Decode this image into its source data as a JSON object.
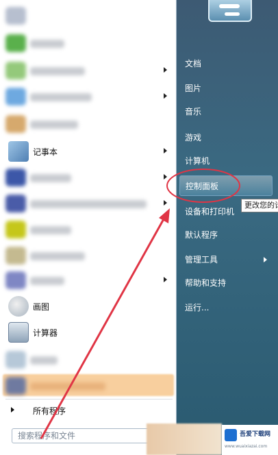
{
  "left_items": [
    {
      "type": "blurred",
      "icon_color": "#b7bfcf",
      "text_w": 0,
      "arrow": false
    },
    {
      "type": "blurred",
      "icon_color": "#5ab04c",
      "text_w": 50,
      "arrow": false
    },
    {
      "type": "blurred",
      "icon_color": "#94c97b",
      "text_w": 80,
      "arrow": true
    },
    {
      "type": "blurred",
      "icon_color": "#6ea9e0",
      "text_w": 90,
      "arrow": true
    },
    {
      "type": "blurred",
      "icon_color": "#d6a96d",
      "text_w": 70,
      "arrow": false
    }
  ],
  "notepad_label": "记事本",
  "paint_label": "画图",
  "calculator_label": "计算器",
  "all_programs_label": "所有程序",
  "search_placeholder": "搜索程序和文件",
  "right_items": [
    {
      "label": "文档",
      "arrow": false
    },
    {
      "label": "图片",
      "arrow": false
    },
    {
      "label": "音乐",
      "arrow": false
    },
    {
      "label": "游戏",
      "arrow": false
    },
    {
      "label": "计算机",
      "arrow": false
    },
    {
      "label": "控制面板",
      "arrow": false,
      "highlighted": true
    },
    {
      "label": "设备和打印机",
      "arrow": false
    },
    {
      "label": "默认程序",
      "arrow": false
    },
    {
      "label": "管理工具",
      "arrow": true
    },
    {
      "label": "帮助和支持",
      "arrow": false
    },
    {
      "label": "运行...",
      "arrow": false
    }
  ],
  "tooltip_text": "更改您的计",
  "watermark_text": "吾爱下载网",
  "watermark_sub": "www.wuaixiazai.com",
  "colors": {
    "annotation_red": "#e03545",
    "panel_bg": "#ffffff",
    "right_bg": "#3a6a82"
  }
}
